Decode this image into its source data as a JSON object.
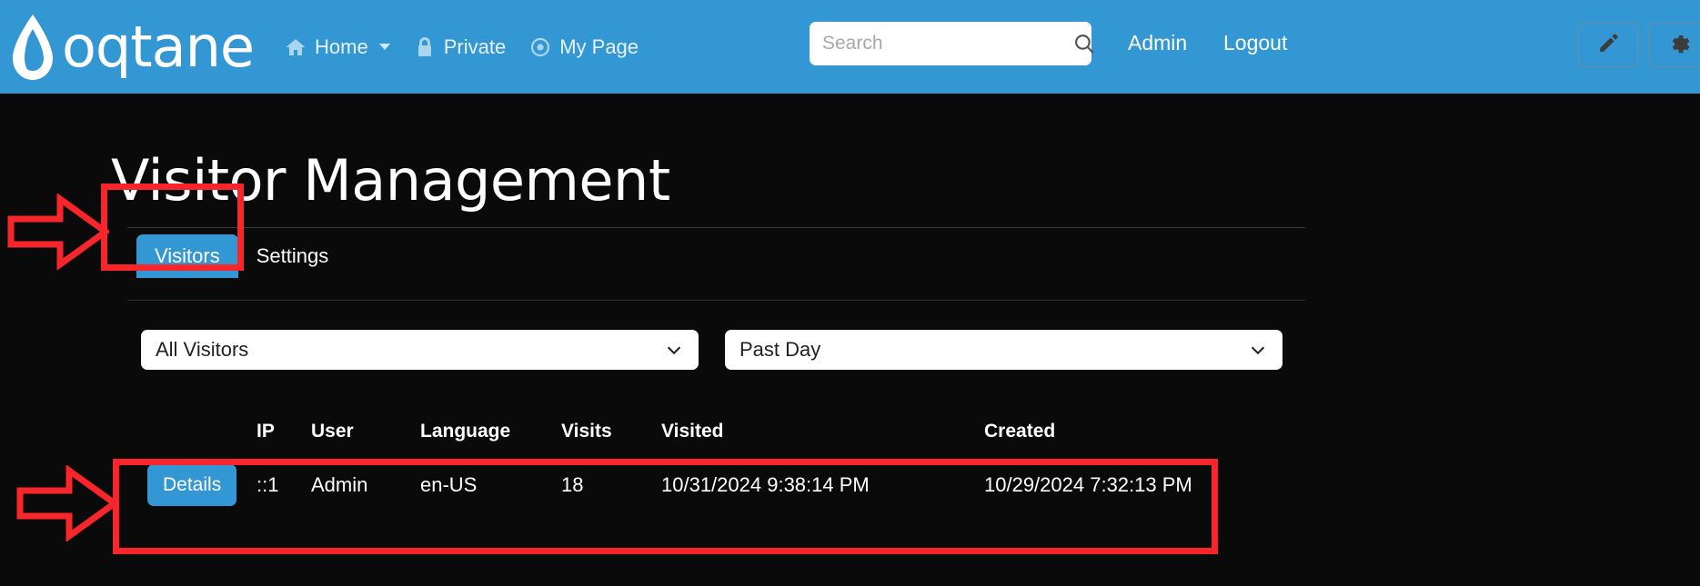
{
  "header": {
    "brand": "oqtane",
    "brand_icon": "water-drop-icon",
    "nav": [
      {
        "label": "Home",
        "icon": "home-icon",
        "has_caret": true
      },
      {
        "label": "Private",
        "icon": "lock-icon",
        "has_caret": false
      },
      {
        "label": "My Page",
        "icon": "target-icon",
        "has_caret": false
      }
    ],
    "search": {
      "placeholder": "Search",
      "value": "",
      "icon": "search-icon"
    },
    "admin_label": "Admin",
    "logout_label": "Logout",
    "edit_icon": "pencil-icon",
    "settings_icon": "gear-icon",
    "bg_color": "#3397d4"
  },
  "main": {
    "page_title": "Visitor Management",
    "tabs": [
      {
        "label": "Visitors",
        "active": true
      },
      {
        "label": "Settings",
        "active": false
      }
    ],
    "filters": {
      "visitor_filter": {
        "value": "All Visitors",
        "icon": "chevron-down-icon"
      },
      "period_filter": {
        "value": "Past Day",
        "icon": "chevron-down-icon"
      }
    },
    "table": {
      "columns": [
        "",
        "IP",
        "User",
        "Language",
        "Visits",
        "Visited",
        "Created"
      ],
      "rows": [
        {
          "action_label": "Details",
          "ip": "::1",
          "user": "Admin",
          "language": "en-US",
          "visits": "18",
          "visited": "10/31/2024 9:38:14 PM",
          "created": "10/29/2024 7:32:13 PM"
        }
      ]
    }
  },
  "annotations": {
    "highlight_color": "#f8252b",
    "items": [
      {
        "name": "tabs-highlight",
        "shape": "rectangle"
      },
      {
        "name": "tabs-arrow",
        "shape": "arrow-right"
      },
      {
        "name": "visitor-row-highlight",
        "shape": "rectangle"
      },
      {
        "name": "visitor-row-arrow",
        "shape": "arrow-right"
      }
    ]
  },
  "theme": {
    "accent": "#3397d4",
    "background": "#0a0a0a",
    "text": "#ffffff"
  }
}
